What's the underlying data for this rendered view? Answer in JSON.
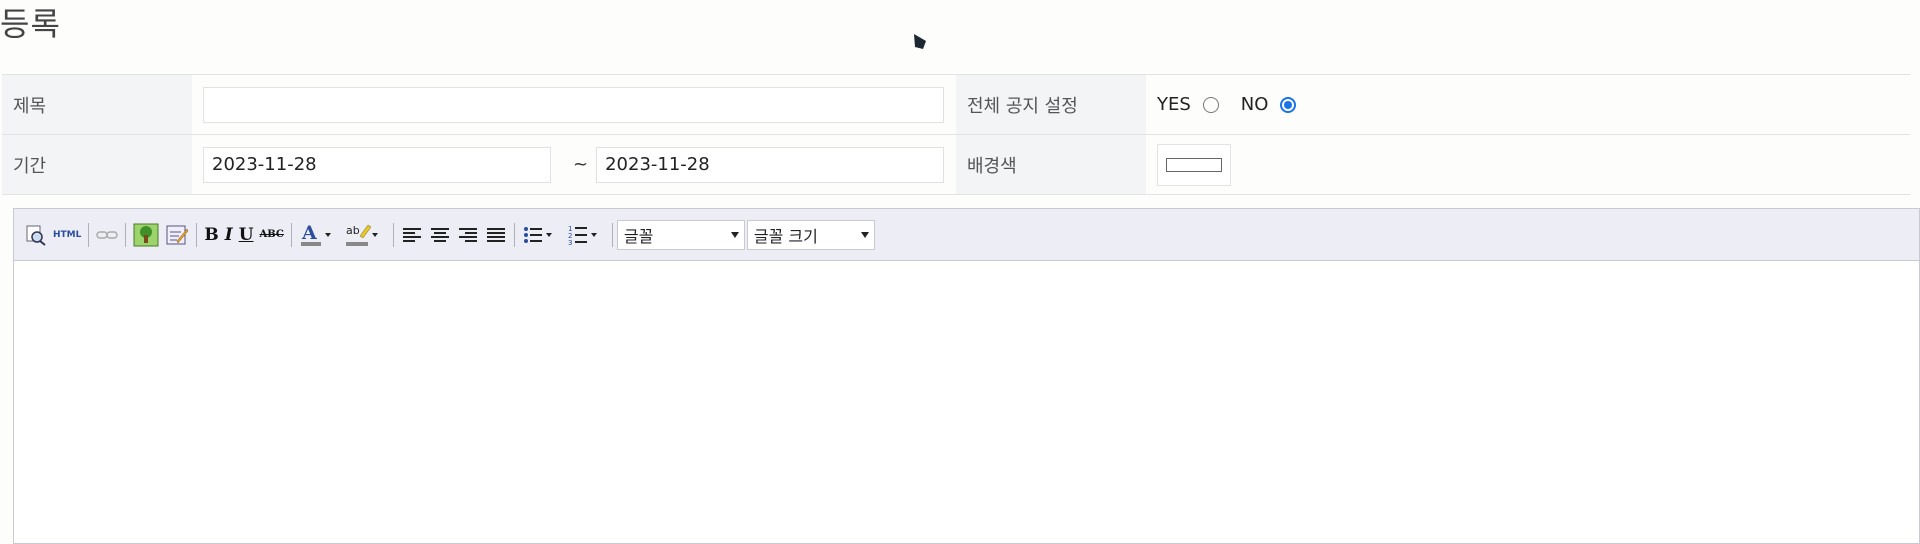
{
  "page": {
    "title": "등록"
  },
  "form": {
    "subject_label": "제목",
    "subject_value": "",
    "notice_label": "전체 공지 설정",
    "notice_yes_label": "YES",
    "notice_no_label": "NO",
    "notice_selected": "NO",
    "period_label": "기간",
    "period_start": "2023-11-28",
    "period_tilde": "~",
    "period_end": "2023-11-28",
    "bgcolor_label": "배경색",
    "bgcolor_value": "#ffffff"
  },
  "editor": {
    "toolbar": {
      "font_family": "글꼴",
      "font_size": "글꼴 크기",
      "bold_glyph": "B",
      "italic_glyph": "I",
      "underline_glyph": "U",
      "strike_glyph": "ABC",
      "html_glyph": "HTML"
    },
    "body": ""
  },
  "colors": {
    "accent": "#1a73e8",
    "label_bg": "#f2f4f6",
    "toolbar_bg": "#ecedf5"
  }
}
